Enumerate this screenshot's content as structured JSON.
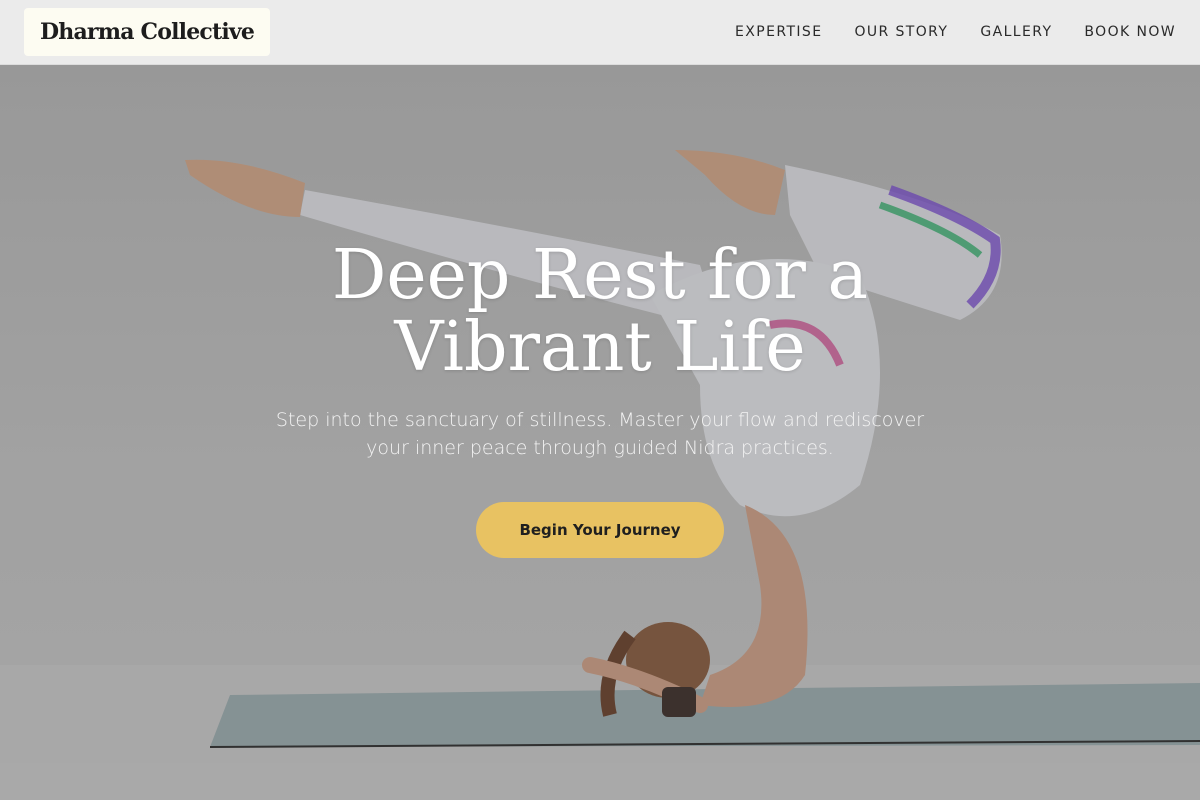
{
  "header": {
    "brand": "Dharma Collective",
    "nav": [
      "EXPERTISE",
      "OUR STORY",
      "GALLERY",
      "BOOK NOW"
    ]
  },
  "hero": {
    "title": "Deep Rest for a Vibrant Life",
    "subtitle": "Step into the sanctuary of stillness. Master your flow and rediscover your inner peace through guided Nidra practices.",
    "cta_label": "Begin Your Journey",
    "image_icon": "yoga-headstand-photo"
  },
  "colors": {
    "accent": "#e8c262",
    "header_bg": "#ebebeb",
    "brand_bg": "#fdfcf2",
    "hero_text": "#ffffff"
  }
}
